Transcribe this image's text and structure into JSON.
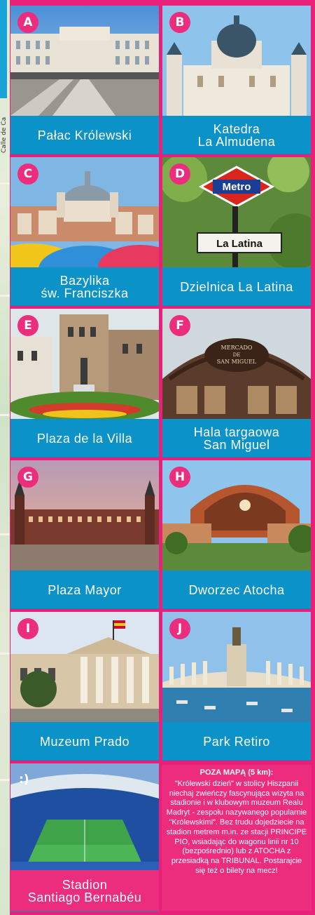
{
  "map_strip": {
    "street_label": "Calle de Ca"
  },
  "tiles": [
    {
      "letter": "A",
      "line1": "Pałac Królewski",
      "line2": ""
    },
    {
      "letter": "B",
      "line1": "Katedra",
      "line2": "La Almudena"
    },
    {
      "letter": "C",
      "line1": "Bazylika",
      "line2": "św. Franciszka"
    },
    {
      "letter": "D",
      "line1": "Dzielnica La Latina",
      "line2": ""
    },
    {
      "letter": "E",
      "line1": "Plaza de la Villa",
      "line2": ""
    },
    {
      "letter": "F",
      "line1": "Hala targaowa",
      "line2": "San Miguel"
    },
    {
      "letter": "G",
      "line1": "Plaza Mayor",
      "line2": ""
    },
    {
      "letter": "H",
      "line1": "Dworzec Atocha",
      "line2": ""
    },
    {
      "letter": "I",
      "line1": "Muzeum Prado",
      "line2": ""
    },
    {
      "letter": "J",
      "line1": "Park Retiro",
      "line2": ""
    },
    {
      "letter": ":)",
      "line1": "Stadion",
      "line2": "Santiago Bernabéu"
    }
  ],
  "photo_text": {
    "metro_sign": "Metro",
    "street_sign": "La Latina",
    "market_sign_1": "MERCADO",
    "market_sign_2": "DE",
    "market_sign_3": "SAN MIGUEL"
  },
  "info_box": {
    "heading": "POZA MAPĄ (5 km):",
    "body": "\"Królewski dzień\" w stolicy Hiszpanii niechaj zwieńczy fascynująca wizyta na stadionie i w klubowym muzeum Realu Madryt - zespołu nazywanego popularnie \"Królewskimi\". Bez trudu dojedziecie na stadion metrem m.in. ze stacji PRINCIPE PIO, wsiadając do wagonu linii nr 10 (bezpośrednio) lub z ATOCHA z przesiadką na TRIBUNAL. Postarajcie się też o bilety na mecz!"
  },
  "colors": {
    "pink": "#ec2c7c",
    "blue": "#0b93c9",
    "frame": "#e8207a"
  }
}
